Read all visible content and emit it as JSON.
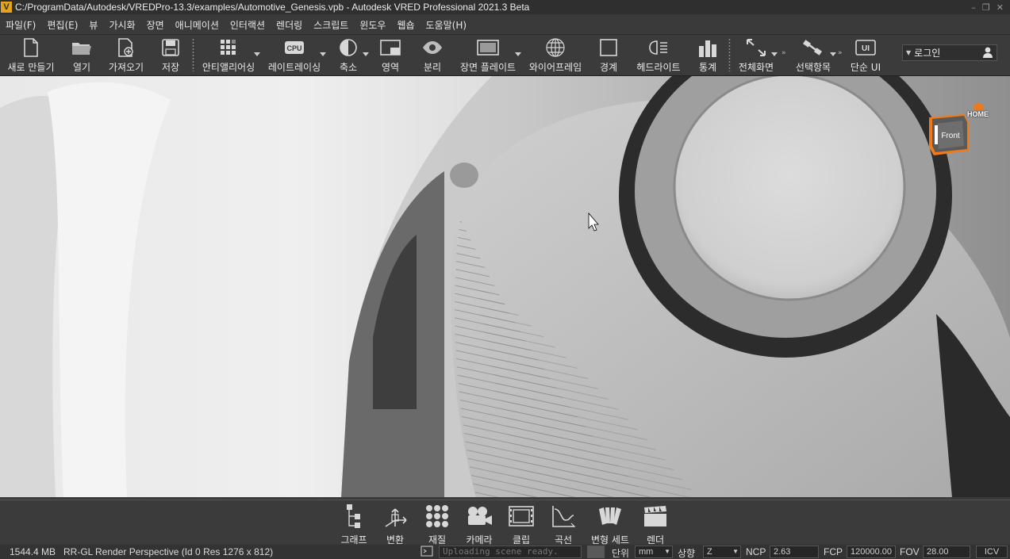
{
  "window": {
    "title": "C:/ProgramData/Autodesk/VREDPro-13.3/examples/Automotive_Genesis.vpb - Autodesk VRED Professional 2021.3 Beta",
    "app_icon_letter": "V"
  },
  "menu": [
    "파일(F)",
    "편집(E)",
    "뷰",
    "가시화",
    "장면",
    "애니메이션",
    "인터랙션",
    "렌더링",
    "스크립트",
    "윈도우",
    "웹숍",
    "도움말(H)"
  ],
  "toolbar": {
    "new": "새로 만들기",
    "open": "열기",
    "import": "가져오기",
    "save": "저장",
    "antialiasing": "안티앨리어싱",
    "raytracing": "레이트레이싱",
    "cpu_badge": "CPU",
    "reduce": "축소",
    "region": "영역",
    "separate": "분리",
    "scene_plate": "장면 플레이트",
    "wireframe": "와이어프레임",
    "bounds": "경계",
    "headlight": "헤드라이트",
    "stats": "통계",
    "fullscreen": "전체화면",
    "selection": "선택항목",
    "simple_ui": "단순 UI",
    "simple_ui_badge": "UI",
    "login": "로그인"
  },
  "viewport": {
    "nav_cube_face": "Front",
    "home_label": "HOME"
  },
  "dock": [
    "그래프",
    "변환",
    "재질",
    "카메라",
    "클립",
    "곡선",
    "변형 세트",
    "렌더"
  ],
  "status": {
    "memory": "1544.4 MB",
    "renderer": "RR-GL",
    "render_info": "Render Perspective (Id 0 Res 1276 x 812)",
    "message": "Uploading scene ready.",
    "units_label": "단위",
    "units_value": "mm",
    "up_label": "상향",
    "up_value": "Z",
    "ncp_label": "NCP",
    "ncp_value": "2.63",
    "fcp_label": "FCP",
    "fcp_value": "120000.00",
    "fov_label": "FOV",
    "fov_value": "28.00",
    "icv": "ICV"
  },
  "colors": {
    "accent": "#e6a21a",
    "nav_cube_orange": "#f07a1a",
    "background": "#3a3a3a"
  }
}
